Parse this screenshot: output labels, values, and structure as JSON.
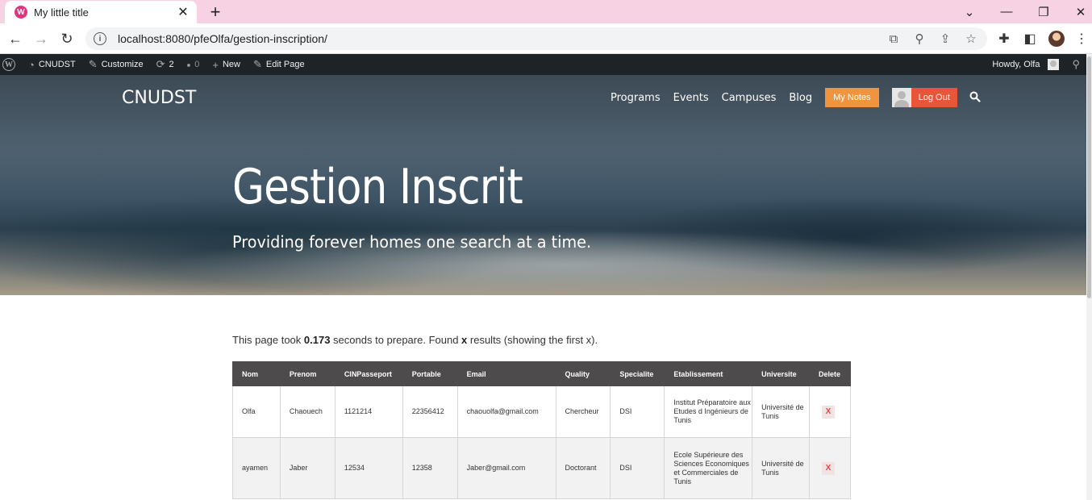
{
  "browser": {
    "tab_title": "My little title",
    "favicon_letter": "W",
    "url": "localhost:8080/pfeOlfa/gestion-inscription/"
  },
  "adminbar": {
    "site": "CNUDST",
    "customize": "Customize",
    "updates": "2",
    "comments": "0",
    "new": "New",
    "edit_page": "Edit Page",
    "howdy": "Howdy, Olfa"
  },
  "header": {
    "site_title": "CNUDST",
    "nav": [
      "Programs",
      "Events",
      "Campuses",
      "Blog"
    ],
    "my_notes": "My Notes",
    "log_out": "Log Out"
  },
  "hero": {
    "title": "Gestion Inscrit",
    "subtitle": "Providing forever homes one search at a time."
  },
  "stats": {
    "prefix": "This page took ",
    "seconds": "0.173",
    "middle": " seconds to prepare. Found ",
    "count": "x",
    "suffix": " results (showing the first x)."
  },
  "table": {
    "headers": [
      "Nom",
      "Prenom",
      "CINPasseport",
      "Portable",
      "Email",
      "Quality",
      "Specialite",
      "Etablissement",
      "Universite",
      "Delete"
    ],
    "rows": [
      [
        "Olfa",
        "Chaouech",
        "1121214",
        "22356412",
        "chaouolfa@gmail.com",
        "Chercheur",
        "DSI",
        "Institut Préparatoire aux Etudes d Ingénieurs de Tunis",
        "Université de Tunis",
        "X"
      ],
      [
        "ayamen",
        "Jaber",
        "12534",
        "12358",
        "Jaber@gmail.com",
        "Doctorant",
        "DSI",
        "Ecole Supérieure des Sciences Economiques et Commerciales de Tunis",
        "Université de Tunis",
        "X"
      ]
    ]
  },
  "colors": {
    "tabstrip": "#f6d2e3",
    "adminbar": "#1d2327",
    "my_notes_btn": "#f0943d",
    "logout_btn": "#e8563a",
    "table_header": "#4d4b4b"
  }
}
